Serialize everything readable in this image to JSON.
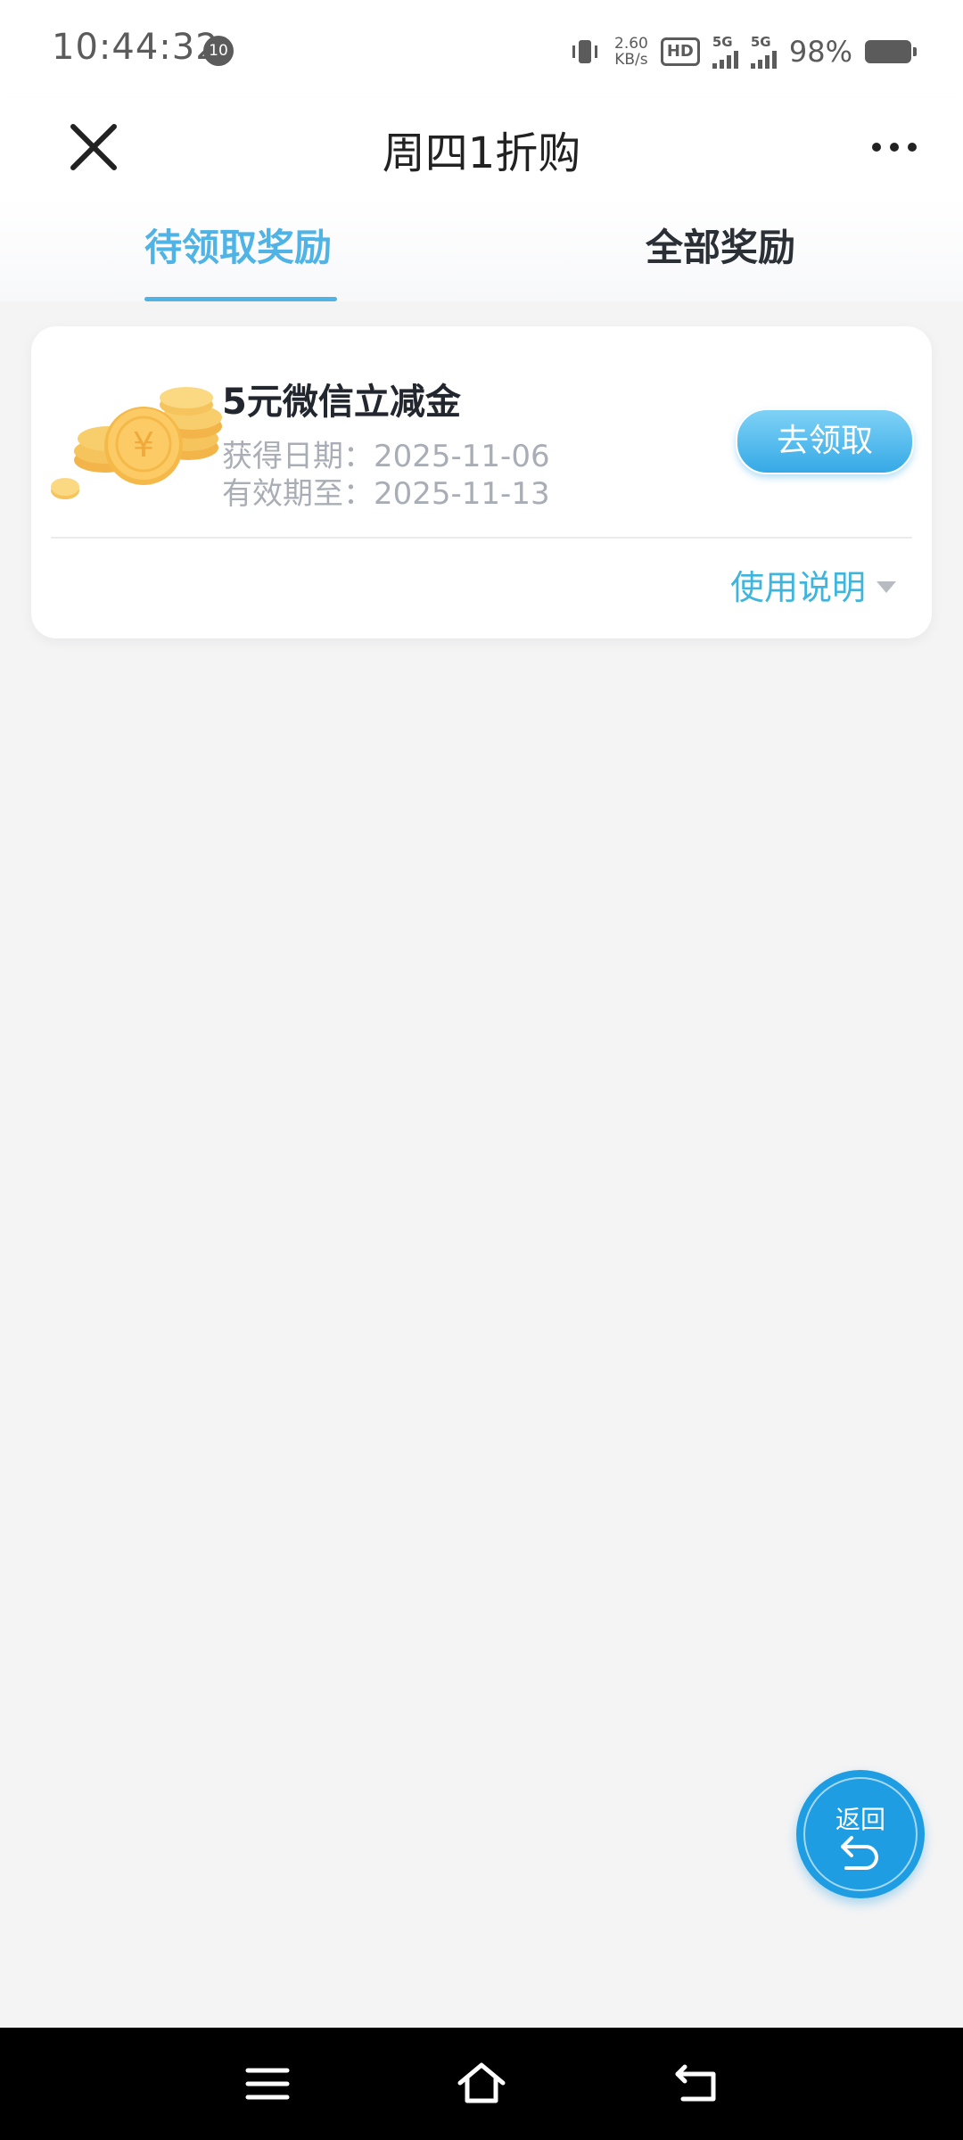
{
  "status_bar": {
    "time": "10:44:32",
    "badge": "10",
    "speed_value": "2.60",
    "speed_unit": "KB/s",
    "hd_label": "HD",
    "sim1_label": "5G",
    "sim2_label": "5G",
    "battery": "98%"
  },
  "header": {
    "title": "周四1折购"
  },
  "tabs": [
    {
      "label": "待领取奖励",
      "active": true
    },
    {
      "label": "全部奖励",
      "active": false
    }
  ],
  "reward": {
    "title": "5元微信立减金",
    "obtained": "获得日期：2025-11-06",
    "valid_until": "有效期至：2025-11-13",
    "claim_label": "去领取",
    "usage_label": "使用说明"
  },
  "float_back": {
    "label": "返回"
  },
  "colors": {
    "accent": "#4fb3e6",
    "claim_button": "#35a9e6",
    "fab": "#1e9de2",
    "usage_text": "#3fb4dc"
  }
}
